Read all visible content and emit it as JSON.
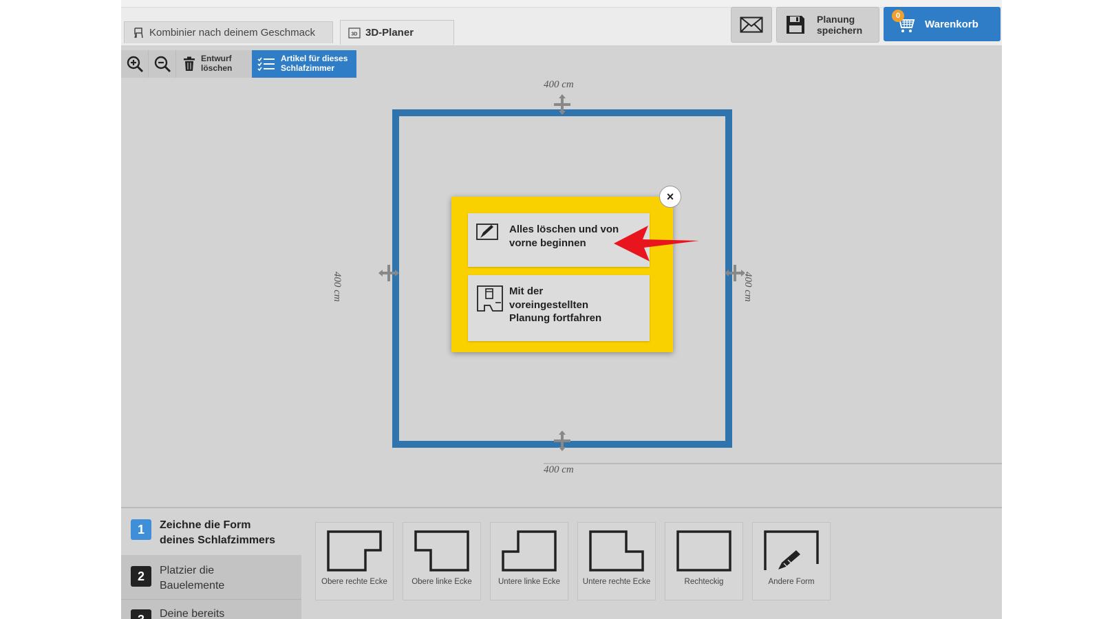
{
  "tabs": [
    {
      "label": "Kombinier nach deinem Geschmack",
      "icon": "chair-icon"
    },
    {
      "label": "3D-Planer",
      "icon": "3d-icon",
      "icon_text": "3D",
      "active": true
    }
  ],
  "header": {
    "mail_icon": "envelope-icon",
    "save_label_line1": "Planung",
    "save_label_line2": "speichern",
    "cart_label": "Warenkorb",
    "cart_count": "0",
    "accent": "#2f7dc6"
  },
  "toolbar": {
    "zoom_in_icon": "zoom-in-icon",
    "zoom_out_icon": "zoom-out-icon",
    "delete_line1": "Entwurf",
    "delete_line2": "löschen",
    "articles_line1": "Artikel für dieses",
    "articles_line2": "Schlafzimmer"
  },
  "room": {
    "dim_top": "400 cm",
    "dim_bottom": "400 cm",
    "dim_left": "400 cm",
    "dim_right": "400 cm",
    "wall_color": "#2f74ad"
  },
  "modal": {
    "close_label": "×",
    "option1_line1": "Alles löschen und von",
    "option1_line2": "vorne beginnen",
    "option2_line1": "Mit der",
    "option2_line2": "voreingestellten",
    "option2_line3": "Planung fortfahren",
    "background": "#f9d000"
  },
  "steps": [
    {
      "num": "1",
      "line1": "Zeichne die Form",
      "line2": "deines Schlafzimmers"
    },
    {
      "num": "2",
      "line1": "Platzier die",
      "line2": "Bauelemente"
    },
    {
      "num": "3",
      "line1": "Deine bereits",
      "line2": ""
    }
  ],
  "shapes": [
    {
      "label": "Obere rechte Ecke"
    },
    {
      "label": "Obere linke Ecke"
    },
    {
      "label": "Untere linke Ecke"
    },
    {
      "label": "Untere rechte Ecke"
    },
    {
      "label": "Rechteckig"
    },
    {
      "label": "Andere Form"
    }
  ]
}
